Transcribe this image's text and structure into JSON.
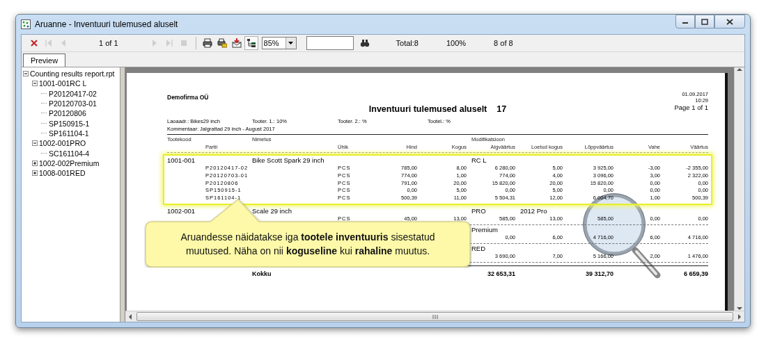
{
  "window": {
    "title": "Aruanne - Inventuuri tulemused aluselt"
  },
  "toolbar": [
    {
      "kind": "close",
      "disabled": false
    },
    {
      "kind": "first",
      "disabled": true
    },
    {
      "kind": "prev",
      "disabled": true
    },
    {
      "kind": "text",
      "text": "1 of 1"
    },
    {
      "kind": "next",
      "disabled": true
    },
    {
      "kind": "last",
      "disabled": true
    },
    {
      "kind": "stop",
      "disabled": true
    },
    {
      "kind": "separator"
    },
    {
      "kind": "print",
      "disabled": false
    },
    {
      "kind": "print_setup",
      "disabled": false
    },
    {
      "kind": "export",
      "disabled": false
    },
    {
      "kind": "tree_toggle",
      "on": true
    },
    {
      "kind": "zoom",
      "value": "85%"
    },
    {
      "kind": "search_field"
    },
    {
      "kind": "find",
      "disabled": false
    },
    {
      "kind": "text",
      "text": "Total:8"
    },
    {
      "kind": "text",
      "text": "100%"
    },
    {
      "kind": "text",
      "text": "8 of 8"
    }
  ],
  "tabs": [
    {
      "label": "Preview",
      "selected": true
    }
  ],
  "tree": [
    {
      "label": "Counting results report.rpt",
      "expanded": true,
      "children": [
        {
          "label": "1001-001RC L",
          "expanded": true,
          "children": [
            {
              "label": "P20120417-02"
            },
            {
              "label": "P20120703-01"
            },
            {
              "label": "P20120806"
            },
            {
              "label": "SP150915-1"
            },
            {
              "label": "SP161104-1"
            }
          ]
        },
        {
          "label": "1002-001PRO",
          "expanded": true,
          "children": [
            {
              "label": "SC161104-4"
            }
          ]
        },
        {
          "label": "1002-002Premium",
          "expanded": false
        },
        {
          "label": "1008-001RED",
          "expanded": false
        }
      ]
    }
  ],
  "report": {
    "company": "Demofirma OÜ",
    "title": "Inventuuri tulemused aluselt",
    "number": "17",
    "date": "01.09.2017",
    "time": "10:29",
    "page": "Page 1 of 1",
    "params": [
      "Laoaadr.: Bikes29 inch",
      "Tooter. 1.: 10%",
      "Tooter. 2.: %",
      "Tootel.: %"
    ],
    "comment": "Kommentaar: Jalgrattad 29 inch - August 2017",
    "header_top": {
      "code": "Tootekood",
      "name": "Nimetus",
      "modification": "Modifikatsioon"
    },
    "columns": [
      "Partii",
      "Ühik",
      "Hind",
      "Kogus",
      "Algväärtus",
      "Loetud kogus",
      "Lõppväärtus",
      "Vahe",
      "Väärtus"
    ],
    "groups": [
      {
        "code": "1001-001",
        "name": "Bike Scott Spark 29 inch",
        "modification": "RC L",
        "highlighted": true,
        "rows": [
          {
            "cells": [
              "P20120417-02",
              "PCS",
              "785,00",
              "8,00",
              "6 280,00",
              "5,00",
              "3 925,00",
              "-3,00",
              "-2 355,00"
            ]
          },
          {
            "cells": [
              "P20120703-01",
              "PCS",
              "774,00",
              "1,00",
              "774,00",
              "4,00",
              "3 096,00",
              "3,00",
              "2 322,00"
            ]
          },
          {
            "cells": [
              "P20120806",
              "PCS",
              "791,00",
              "20,00",
              "15 820,00",
              "20,00",
              "15 820,00",
              "0,00",
              "0,00"
            ]
          },
          {
            "cells": [
              "SP150915-1",
              "PCS",
              "0,00",
              "5,00",
              "0,00",
              "5,00",
              "0,00",
              "0,00",
              "0,00"
            ]
          },
          {
            "cells": [
              "SP161104-1",
              "PCS",
              "500,39",
              "11,00",
              "5 504,31",
              "12,00",
              "6 004,70",
              "1,00",
              "500,39"
            ]
          }
        ]
      },
      {
        "code": "1002-001",
        "name": "Scale 29 inch",
        "modification": "PRO",
        "modification_2": "2012 Pro",
        "highlighted": false,
        "rows": [
          {
            "cells": [
              null,
              "PCS",
              "45,00",
              "13,00",
              "585,00",
              "13,00",
              "585,00",
              "0,00",
              "0,00"
            ]
          }
        ]
      },
      {
        "modification": "Premium",
        "highlighted": false,
        "rows": [
          {
            "cells": [
              null,
              null,
              null,
              null,
              "0,00",
              "6,00",
              "4 716,00",
              "6,00",
              "4 716,00"
            ]
          }
        ]
      },
      {
        "modification": "RED",
        "highlighted": false,
        "rows": [
          {
            "cells": [
              null,
              null,
              null,
              null,
              "3 690,00",
              "7,00",
              "5 166,00",
              "2,00",
              "1 476,00"
            ]
          }
        ]
      }
    ],
    "totals": {
      "label": "Kokku",
      "start_value": "32 653,31",
      "end_value": "39 312,70",
      "diff_value": "6 659,39"
    }
  },
  "callout": {
    "text": "Aruandesse näidatakse iga **tootele inventuuris** sisestatud muutused. Näha on nii **koguseline** kui **rahaline** muutus."
  }
}
